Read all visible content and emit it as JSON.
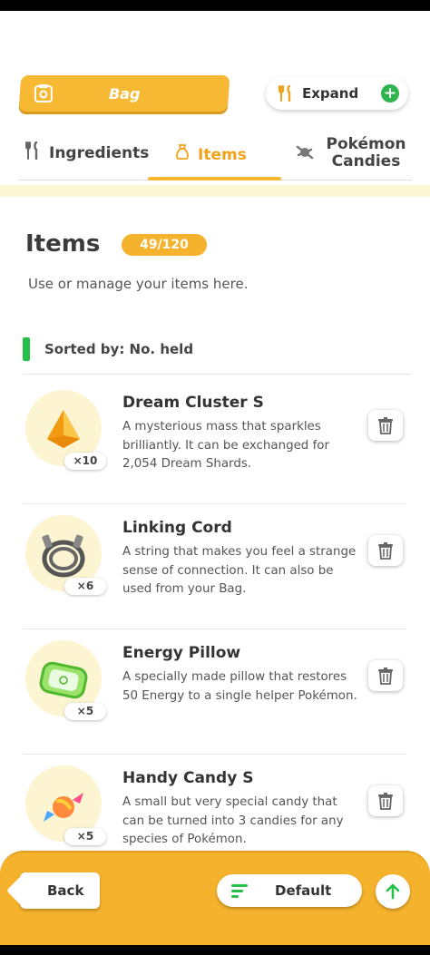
{
  "header": {
    "bag_label": "Bag",
    "expand_label": "Expand",
    "expand_plus": "+"
  },
  "tabs": [
    {
      "label": "Ingredients",
      "icon": "fork-knife-icon",
      "active": false
    },
    {
      "label": "Items",
      "icon": "bag-icon",
      "active": true
    },
    {
      "label": "Pokémon Candies",
      "icon": "candy-icon",
      "active": false
    }
  ],
  "page": {
    "title": "Items",
    "count": "49/120",
    "subtitle": "Use or manage your items here.",
    "sort_label": "Sorted by: No. held"
  },
  "items": [
    {
      "name": "Dream Cluster S",
      "qty": "×10",
      "icon": "dream-cluster-icon",
      "desc": "A mysterious mass that sparkles brilliantly. It can be exchanged for 2,054 Dream Shards."
    },
    {
      "name": "Linking Cord",
      "qty": "×6",
      "icon": "linking-cord-icon",
      "desc": "A string that makes you feel a strange sense of connection. It can also be used from your Bag."
    },
    {
      "name": "Energy Pillow",
      "qty": "×5",
      "icon": "energy-pillow-icon",
      "desc": "A specially made pillow that restores 50 Energy to a single helper Pokémon."
    },
    {
      "name": "Handy Candy S",
      "qty": "×5",
      "icon": "handy-candy-icon",
      "desc": "A small but very special candy that can be turned into 3 candies for any species of Pokémon."
    }
  ],
  "footer": {
    "back_label": "Back",
    "sort_label": "Default"
  },
  "colors": {
    "accent": "#f5b22c",
    "active_tab": "#f0a21a",
    "green": "#25c04a"
  }
}
